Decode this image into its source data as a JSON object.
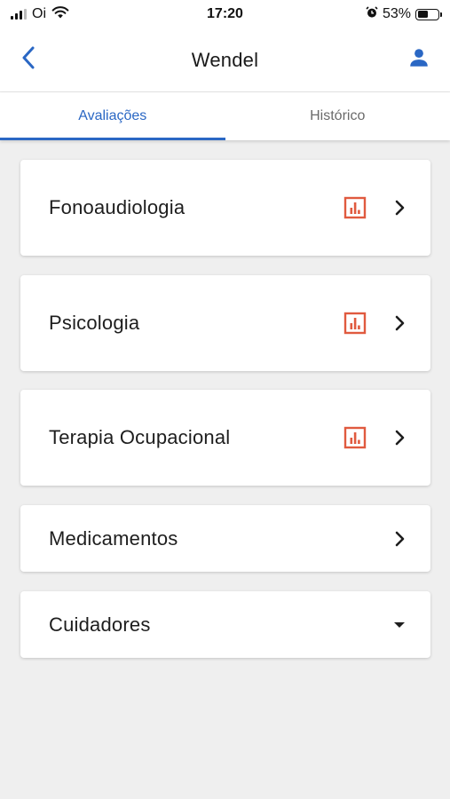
{
  "status_bar": {
    "carrier": "Oi",
    "time": "17:20",
    "battery_percent": "53%",
    "battery_level": 0.53
  },
  "app_bar": {
    "title": "Wendel",
    "icons": {
      "back": "chevron-left-icon",
      "profile": "person-icon"
    }
  },
  "tabs": [
    {
      "label": "Avaliações",
      "active": true
    },
    {
      "label": "Histórico",
      "active": false
    }
  ],
  "sections": [
    {
      "label": "Fonoaudiologia",
      "has_chart": true,
      "trailing": "chevron-right-icon"
    },
    {
      "label": "Psicologia",
      "has_chart": true,
      "trailing": "chevron-right-icon"
    },
    {
      "label": "Terapia Ocupacional",
      "has_chart": true,
      "trailing": "chevron-right-icon"
    },
    {
      "label": "Medicamentos",
      "has_chart": false,
      "trailing": "chevron-right-icon"
    },
    {
      "label": "Cuidadores",
      "has_chart": false,
      "trailing": "caret-down-icon"
    }
  ],
  "colors": {
    "accent": "#2a67c4",
    "chart_icon": "#e05a3f",
    "background": "#efefef"
  }
}
